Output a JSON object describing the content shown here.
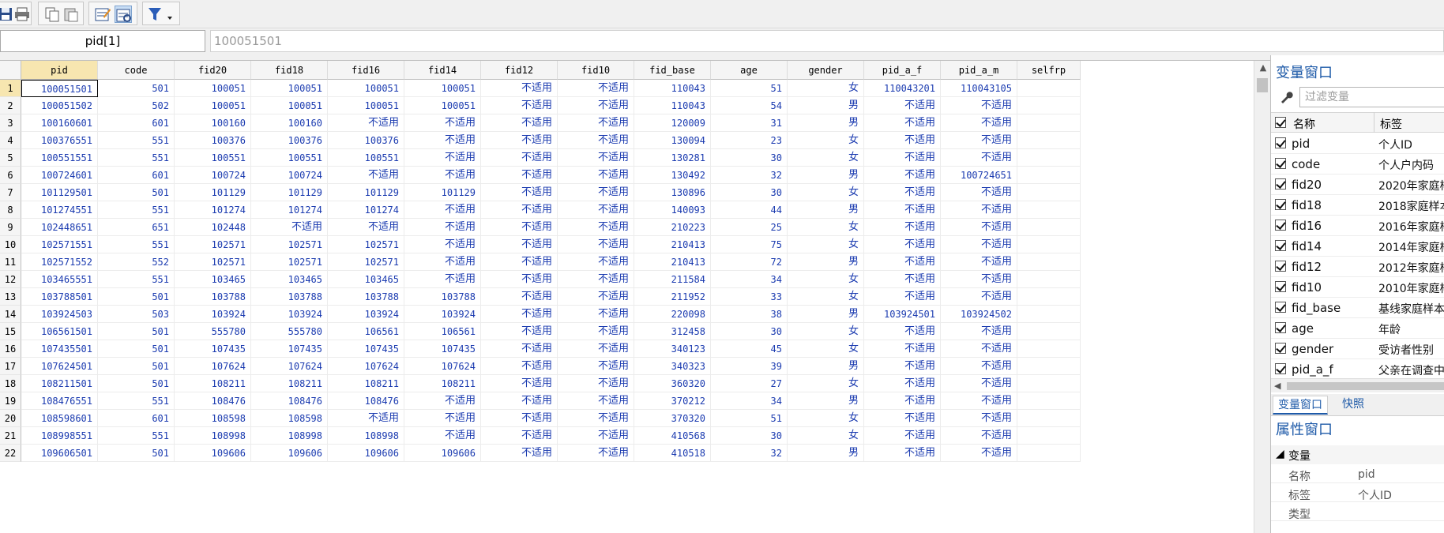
{
  "toolbar": {
    "buttons": [
      "save-icon",
      "print-icon",
      "copy-icon",
      "paste-icon",
      "edit-icon",
      "browse-icon",
      "filter-icon"
    ]
  },
  "command": {
    "cell_name": "pid[1]",
    "cell_value": "100051501"
  },
  "grid": {
    "columns": [
      "pid",
      "code",
      "fid20",
      "fid18",
      "fid16",
      "fid14",
      "fid12",
      "fid10",
      "fid_base",
      "age",
      "gender",
      "pid_a_f",
      "pid_a_m",
      "selfrp"
    ],
    "rows": [
      [
        "100051501",
        "501",
        "100051",
        "100051",
        "100051",
        "100051",
        "不适用",
        "不适用",
        "110043",
        "51",
        "女",
        "110043201",
        "110043105",
        ""
      ],
      [
        "100051502",
        "502",
        "100051",
        "100051",
        "100051",
        "100051",
        "不适用",
        "不适用",
        "110043",
        "54",
        "男",
        "不适用",
        "不适用",
        ""
      ],
      [
        "100160601",
        "601",
        "100160",
        "100160",
        "不适用",
        "不适用",
        "不适用",
        "不适用",
        "120009",
        "31",
        "男",
        "不适用",
        "不适用",
        ""
      ],
      [
        "100376551",
        "551",
        "100376",
        "100376",
        "100376",
        "不适用",
        "不适用",
        "不适用",
        "130094",
        "23",
        "女",
        "不适用",
        "不适用",
        ""
      ],
      [
        "100551551",
        "551",
        "100551",
        "100551",
        "100551",
        "不适用",
        "不适用",
        "不适用",
        "130281",
        "30",
        "女",
        "不适用",
        "不适用",
        ""
      ],
      [
        "100724601",
        "601",
        "100724",
        "100724",
        "不适用",
        "不适用",
        "不适用",
        "不适用",
        "130492",
        "32",
        "男",
        "不适用",
        "100724651",
        ""
      ],
      [
        "101129501",
        "501",
        "101129",
        "101129",
        "101129",
        "101129",
        "不适用",
        "不适用",
        "130896",
        "30",
        "女",
        "不适用",
        "不适用",
        ""
      ],
      [
        "101274551",
        "551",
        "101274",
        "101274",
        "101274",
        "不适用",
        "不适用",
        "不适用",
        "140093",
        "44",
        "男",
        "不适用",
        "不适用",
        ""
      ],
      [
        "102448651",
        "651",
        "102448",
        "不适用",
        "不适用",
        "不适用",
        "不适用",
        "不适用",
        "210223",
        "25",
        "女",
        "不适用",
        "不适用",
        ""
      ],
      [
        "102571551",
        "551",
        "102571",
        "102571",
        "102571",
        "不适用",
        "不适用",
        "不适用",
        "210413",
        "75",
        "女",
        "不适用",
        "不适用",
        ""
      ],
      [
        "102571552",
        "552",
        "102571",
        "102571",
        "102571",
        "不适用",
        "不适用",
        "不适用",
        "210413",
        "72",
        "男",
        "不适用",
        "不适用",
        ""
      ],
      [
        "103465551",
        "551",
        "103465",
        "103465",
        "103465",
        "不适用",
        "不适用",
        "不适用",
        "211584",
        "34",
        "女",
        "不适用",
        "不适用",
        ""
      ],
      [
        "103788501",
        "501",
        "103788",
        "103788",
        "103788",
        "103788",
        "不适用",
        "不适用",
        "211952",
        "33",
        "女",
        "不适用",
        "不适用",
        ""
      ],
      [
        "103924503",
        "503",
        "103924",
        "103924",
        "103924",
        "103924",
        "不适用",
        "不适用",
        "220098",
        "38",
        "男",
        "103924501",
        "103924502",
        ""
      ],
      [
        "106561501",
        "501",
        "555780",
        "555780",
        "106561",
        "106561",
        "不适用",
        "不适用",
        "312458",
        "30",
        "女",
        "不适用",
        "不适用",
        ""
      ],
      [
        "107435501",
        "501",
        "107435",
        "107435",
        "107435",
        "107435",
        "不适用",
        "不适用",
        "340123",
        "45",
        "女",
        "不适用",
        "不适用",
        ""
      ],
      [
        "107624501",
        "501",
        "107624",
        "107624",
        "107624",
        "107624",
        "不适用",
        "不适用",
        "340323",
        "39",
        "男",
        "不适用",
        "不适用",
        ""
      ],
      [
        "108211501",
        "501",
        "108211",
        "108211",
        "108211",
        "108211",
        "不适用",
        "不适用",
        "360320",
        "27",
        "女",
        "不适用",
        "不适用",
        ""
      ],
      [
        "108476551",
        "551",
        "108476",
        "108476",
        "108476",
        "不适用",
        "不适用",
        "不适用",
        "370212",
        "34",
        "男",
        "不适用",
        "不适用",
        ""
      ],
      [
        "108598601",
        "601",
        "108598",
        "108598",
        "不适用",
        "不适用",
        "不适用",
        "不适用",
        "370320",
        "51",
        "女",
        "不适用",
        "不适用",
        ""
      ],
      [
        "108998551",
        "551",
        "108998",
        "108998",
        "108998",
        "不适用",
        "不适用",
        "不适用",
        "410568",
        "30",
        "女",
        "不适用",
        "不适用",
        ""
      ],
      [
        "109606501",
        "501",
        "109606",
        "109606",
        "109606",
        "109606",
        "不适用",
        "不适用",
        "410518",
        "32",
        "男",
        "不适用",
        "不适用",
        ""
      ]
    ]
  },
  "variables_panel": {
    "title": "变量窗口",
    "filter_placeholder": "过滤变量",
    "col_name": "名称",
    "col_label": "标签",
    "items": [
      {
        "name": "pid",
        "label": "个人ID"
      },
      {
        "name": "code",
        "label": "个人户内码"
      },
      {
        "name": "fid20",
        "label": "2020年家庭样"
      },
      {
        "name": "fid18",
        "label": "2018家庭样本"
      },
      {
        "name": "fid16",
        "label": "2016年家庭样"
      },
      {
        "name": "fid14",
        "label": "2014年家庭样"
      },
      {
        "name": "fid12",
        "label": "2012年家庭样"
      },
      {
        "name": "fid10",
        "label": "2010年家庭样"
      },
      {
        "name": "fid_base",
        "label": "基线家庭样本"
      },
      {
        "name": "age",
        "label": "年龄"
      },
      {
        "name": "gender",
        "label": "受访者性别"
      },
      {
        "name": "pid_a_f",
        "label": "父亲在调查中"
      }
    ],
    "tabs": [
      "变量窗口",
      "快照"
    ]
  },
  "properties_panel": {
    "title": "属性窗口",
    "section": "变量",
    "rows": [
      {
        "key": "名称",
        "value": "pid"
      },
      {
        "key": "标签",
        "value": "个人ID"
      },
      {
        "key": "类型",
        "value": ""
      }
    ]
  },
  "colors": {
    "cell_text": "#1b3bb0",
    "selected_header": "#f7e6b0",
    "panel_title": "#1e5aa8"
  }
}
